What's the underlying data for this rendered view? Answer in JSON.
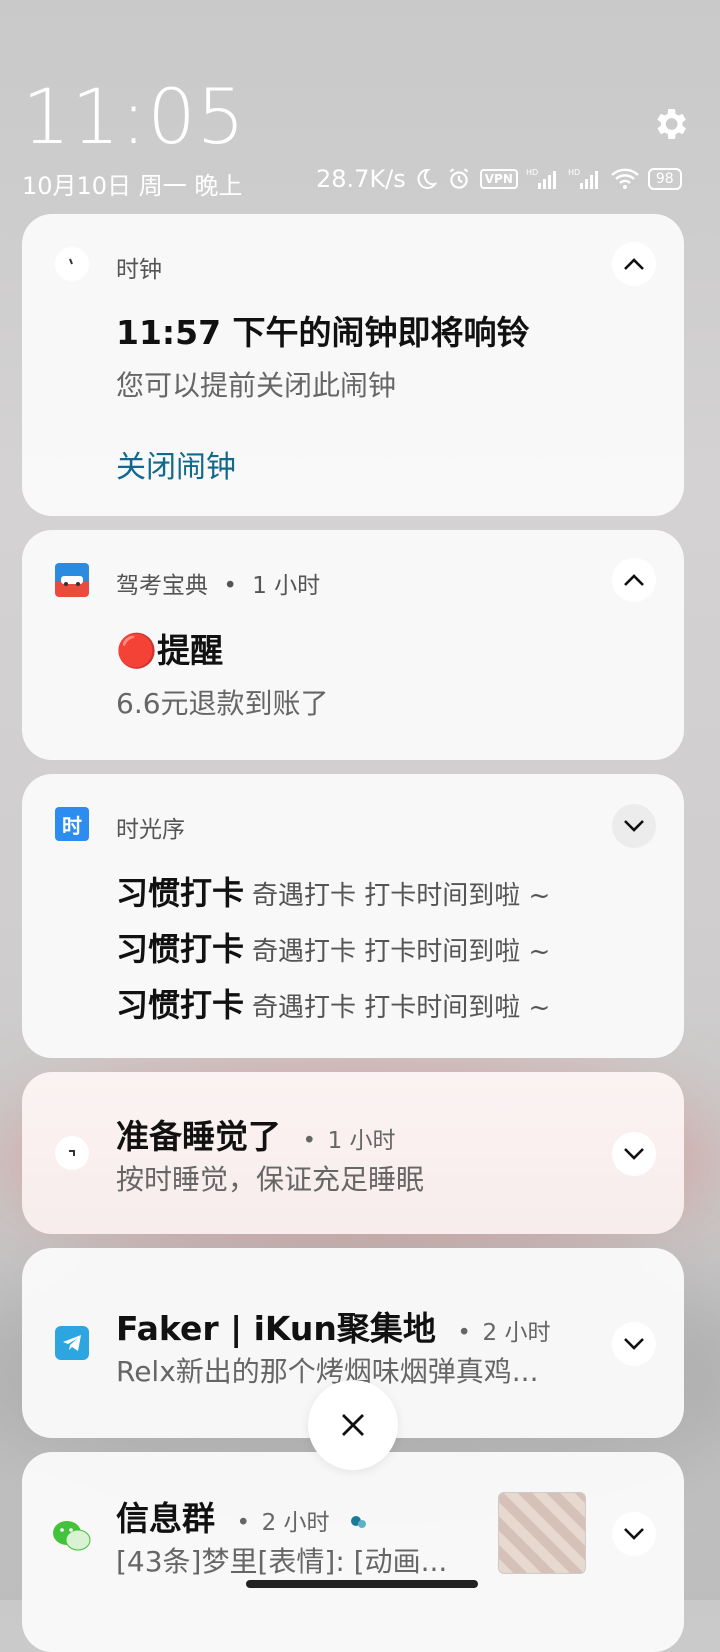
{
  "status": {
    "time": "11:05",
    "date": "10月10日 周一 晚上",
    "network_speed": "28.7K/s",
    "vpn_label": "VPN",
    "battery": "98",
    "icons": [
      "moon-icon",
      "alarm-icon",
      "vpn-icon",
      "signal-hd-icon",
      "signal-hd-icon",
      "wifi-icon",
      "battery-icon"
    ]
  },
  "notifications": [
    {
      "app": "时钟",
      "title": "11:57 下午的闹钟即将响铃",
      "body": "您可以提前关闭此闹钟",
      "action": "关闭闹钟"
    },
    {
      "app": "驾考宝典",
      "time_ago": "1 小时",
      "title_emoji": "🔴",
      "title": "提醒",
      "body": "6.6元退款到账了"
    },
    {
      "app": "时光序",
      "app_icon_char": "时",
      "rows": [
        {
          "title": "习惯打卡",
          "text": "奇遇打卡  打卡时间到啦 ~"
        },
        {
          "title": "习惯打卡",
          "text": "奇遇打卡  打卡时间到啦 ~"
        },
        {
          "title": "习惯打卡",
          "text": "奇遇打卡  打卡时间到啦 ~"
        }
      ]
    },
    {
      "title": "准备睡觉了",
      "time_ago": "1 小时",
      "body": "按时睡觉，保证充足睡眠"
    },
    {
      "title": "Faker | iKun聚集地",
      "time_ago": "2 小时",
      "body": "Relx新出的那个烤烟味烟弹真鸡..."
    },
    {
      "title": "信息群",
      "time_ago": "2 小时",
      "body": "[43条]梦里[表情]: [动画..."
    }
  ],
  "colors": {
    "accent": "#12688d",
    "card": "#fafafa",
    "sleep_card": "#f8ecec"
  }
}
